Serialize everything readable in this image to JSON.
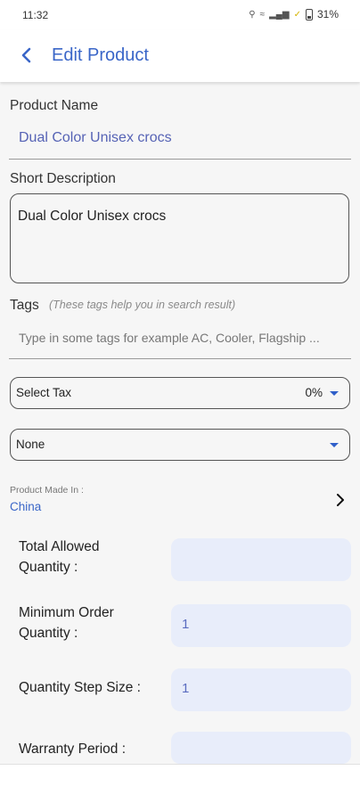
{
  "status_bar": {
    "time": "11:32",
    "battery": "31%"
  },
  "app_bar": {
    "title": "Edit Product"
  },
  "product_name": {
    "label": "Product Name",
    "value": "Dual Color Unisex crocs"
  },
  "short_description": {
    "label": "Short Description",
    "value": "Dual Color Unisex crocs"
  },
  "tags": {
    "label": "Tags",
    "hint": "(These tags help you in search result)",
    "placeholder": "Type in some tags for example AC, Cooler, Flagship ..."
  },
  "tax_select": {
    "label": "Select Tax",
    "value": "0%"
  },
  "second_select": {
    "value": "None"
  },
  "made_in": {
    "label": "Product Made In :",
    "value": "China"
  },
  "quantity_fields": [
    {
      "label_line1": "Total Allowed",
      "label_line2": "Quantity :",
      "value": ""
    },
    {
      "label_line1": "Minimum Order",
      "label_line2": "Quantity :",
      "value": "1"
    },
    {
      "label_line1": "Quantity Step Size :",
      "label_line2": "",
      "value": "1"
    },
    {
      "label_line1": "Warranty Period :",
      "label_line2": "",
      "value": ""
    }
  ],
  "colors": {
    "accent": "#3a66c8",
    "value_text": "#5663b5",
    "input_fill": "#e8edfa"
  }
}
